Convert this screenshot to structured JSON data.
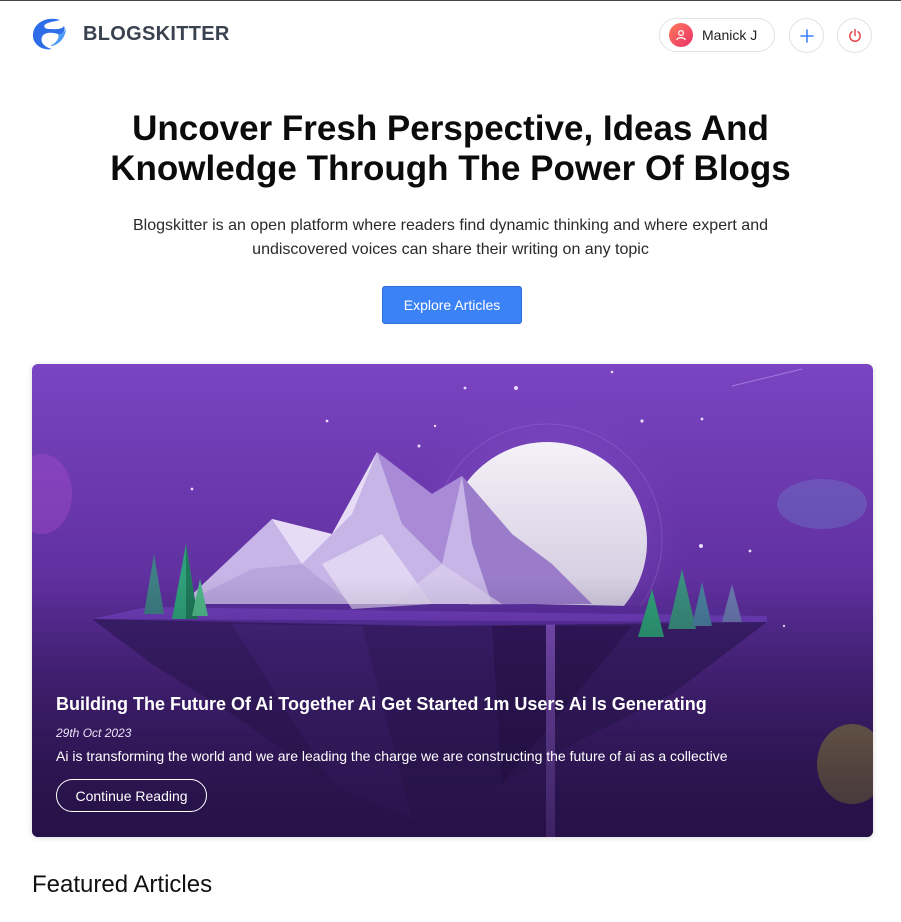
{
  "brand": {
    "name": "BLOGSKITTER",
    "accent": "#3b82f6"
  },
  "header": {
    "user_name": "Manick J",
    "add_icon": "plus-icon",
    "logout_icon": "power-icon"
  },
  "hero": {
    "title": "Uncover Fresh Perspective, Ideas And Knowledge Through The Power Of Blogs",
    "subtitle": "Blogskitter is an open platform where readers find dynamic thinking and where expert and undiscovered voices can share their writing on any topic",
    "cta_label": "Explore Articles"
  },
  "featured_post": {
    "title": "Building The Future Of Ai Together Ai Get Started 1m Users Ai Is Generating",
    "date": "29th Oct 2023",
    "excerpt": "Ai is transforming the world and we are leading the charge we are constructing the future of ai as a collective",
    "cta_label": "Continue Reading"
  },
  "sections": {
    "featured_title": "Featured Articles"
  },
  "colors": {
    "card_bg_top": "#7b44c2",
    "card_bg_bottom": "#3a1c6c",
    "logout": "#e5484d"
  }
}
